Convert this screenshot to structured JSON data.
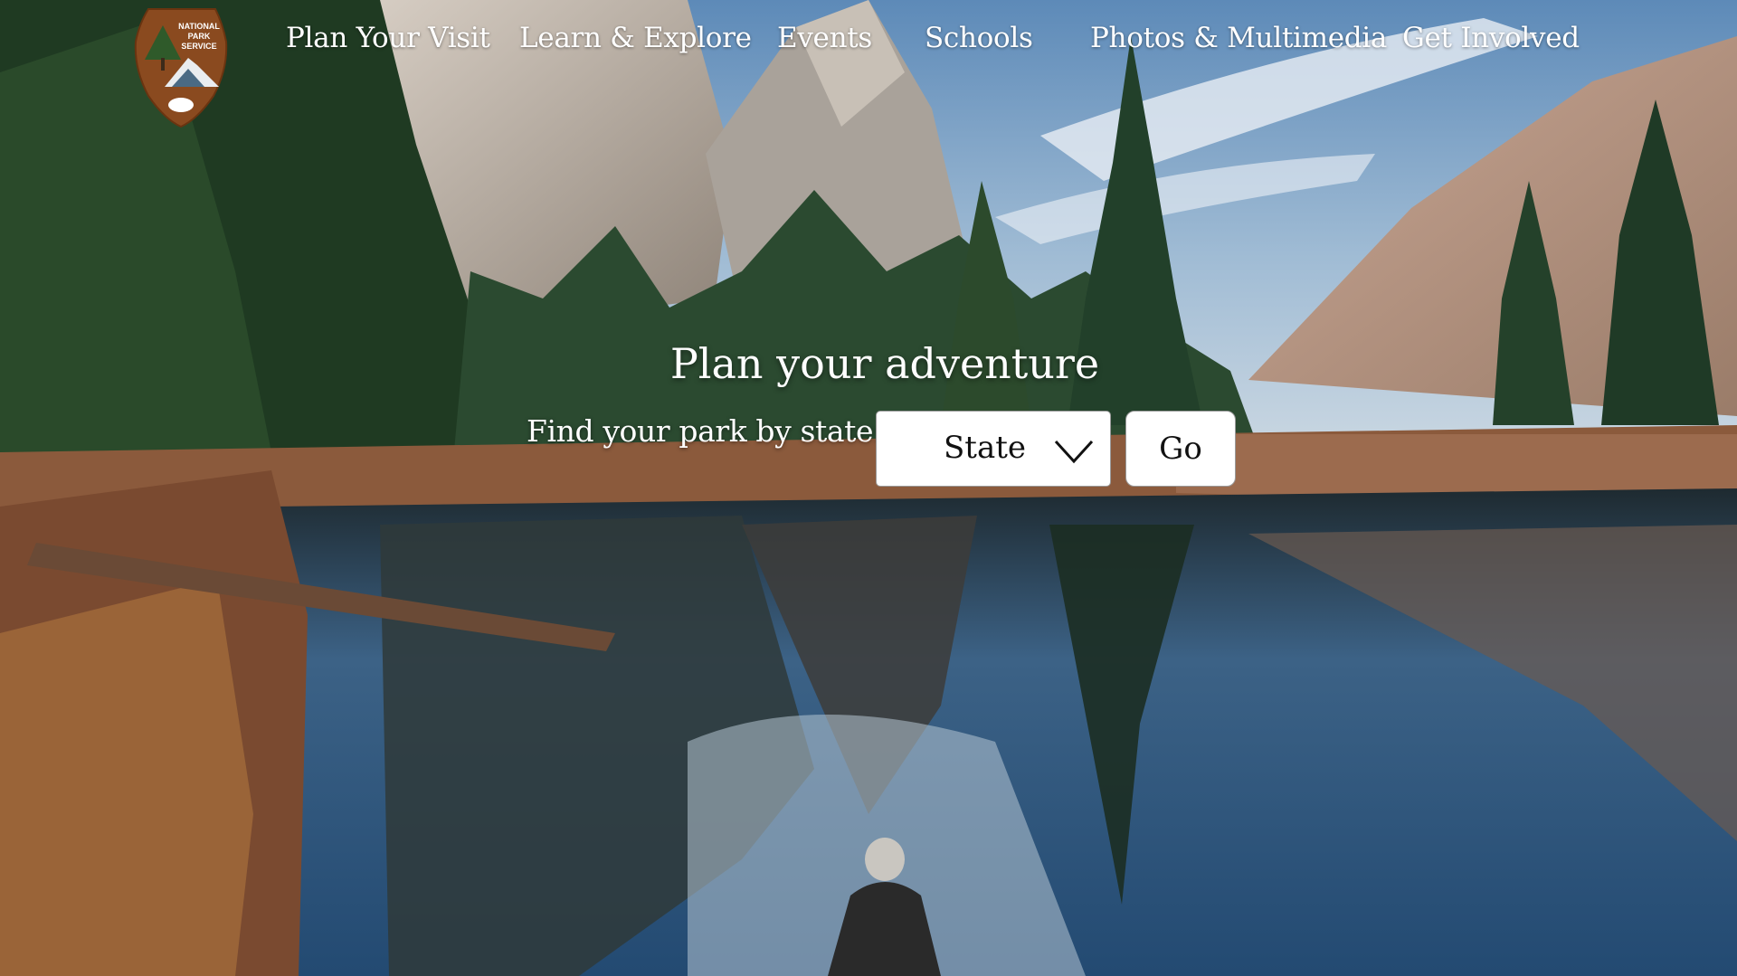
{
  "brand": {
    "logo_icon": "nps-arrowhead-icon",
    "logo_text_lines": [
      "NATIONAL",
      "PARK",
      "SERVICE"
    ],
    "colors": {
      "arrowhead_brown": "#8a4a1f",
      "tree_green": "#2f5a2a",
      "bison_white": "#ffffff"
    }
  },
  "nav": {
    "items": [
      {
        "label": "Plan Your Visit"
      },
      {
        "label": "Learn & Explore"
      },
      {
        "label": "Events"
      },
      {
        "label": "Schools"
      },
      {
        "label": "Photos & Multimedia"
      },
      {
        "label": "Get Involved"
      }
    ]
  },
  "hero": {
    "headline": "Plan your adventure",
    "find_label": "Find your park by state:",
    "state_select": {
      "selected": "State",
      "icon": "chevron-down-icon"
    },
    "go_label": "Go",
    "background": "mountain-lake-reflection-photo"
  }
}
